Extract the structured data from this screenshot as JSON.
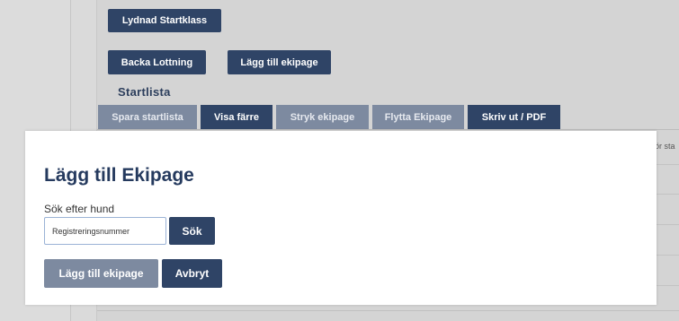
{
  "background": {
    "buttons": {
      "lydnad_startklass": "Lydnad Startklass",
      "backa_lottning": "Backa Lottning",
      "lagg_till_ekipage": "Lägg till ekipage"
    },
    "section_title": "Startlista",
    "tabs": [
      {
        "label": "Spara startlista",
        "enabled": false
      },
      {
        "label": "Visa färre",
        "enabled": true
      },
      {
        "label": "Stryk ekipage",
        "enabled": false
      },
      {
        "label": "Flytta Ekipage",
        "enabled": false
      },
      {
        "label": "Skriv ut / PDF",
        "enabled": true
      }
    ],
    "column_header_fragment": "ör sta"
  },
  "modal": {
    "title": "Lägg till Ekipage",
    "search_label": "Sök efter hund",
    "search_placeholder": "Registreringsnummer",
    "search_value": "",
    "search_button": "Sök",
    "add_button": "Lägg till ekipage",
    "cancel_button": "Avbryt"
  },
  "colors": {
    "primary_dark": "#2f4466",
    "primary_muted": "#7d8aa0",
    "title_navy": "#253a5e",
    "overlay_gray": "#d9d9d9"
  }
}
